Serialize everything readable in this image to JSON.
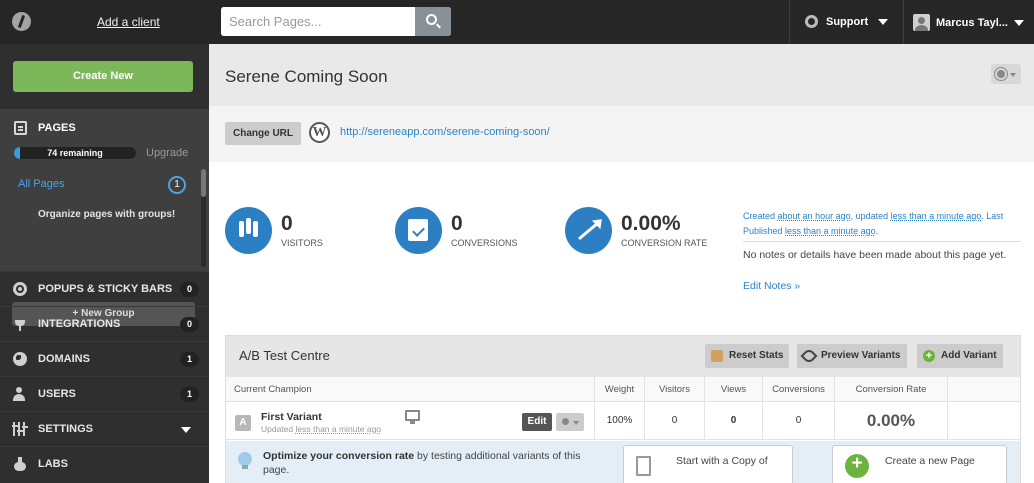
{
  "topbar": {
    "add_client": "Add a client",
    "search_placeholder": "Search Pages...",
    "support_label": "Support",
    "user_name": "Marcus Tayl..."
  },
  "sidebar": {
    "create_new": "Create New",
    "pages_label": "PAGES",
    "remaining_text": "74 remaining",
    "remaining_fraction": 0.05,
    "upgrade": "Upgrade",
    "all_pages": "All Pages",
    "all_pages_count": "1",
    "organize_text": "Organize pages with groups!",
    "new_group": "+ New Group",
    "items": [
      {
        "label": "POPUPS & STICKY BARS",
        "badge": "0",
        "icon": "popup-icon"
      },
      {
        "label": "INTEGRATIONS",
        "badge": "0",
        "icon": "plug-icon"
      },
      {
        "label": "DOMAINS",
        "badge": "1",
        "icon": "globe-icon"
      },
      {
        "label": "USERS",
        "badge": "1",
        "icon": "users-icon"
      },
      {
        "label": "SETTINGS",
        "badge": "",
        "icon": "settings-icon"
      },
      {
        "label": "LABS",
        "badge": "",
        "icon": "labs-icon"
      }
    ]
  },
  "page": {
    "title": "Serene Coming Soon",
    "change_url": "Change URL",
    "url": "http://sereneapp.com/serene-coming-soon/"
  },
  "stats": {
    "visitors": {
      "value": "0",
      "label": "VISITORS"
    },
    "conversions": {
      "value": "0",
      "label": "CONVERSIONS"
    },
    "rate": {
      "value": "0.00%",
      "label": "CONVERSION RATE"
    }
  },
  "meta": {
    "created_prefix": "Created ",
    "created_ago": "about an hour ago",
    "updated_prefix": ", updated ",
    "updated_ago": "less than a minute ago",
    "published_prefix": ". Last Published ",
    "published_ago": "less than a minute ago",
    "end": ".",
    "notes_text": "No notes or details have been made about this page yet.",
    "edit_notes": "Edit Notes »"
  },
  "ab": {
    "title": "A/B Test Centre",
    "reset_stats": "Reset Stats",
    "preview_variants": "Preview Variants",
    "add_variant": "Add Variant",
    "headers": {
      "champion": "Current Champion",
      "weight": "Weight",
      "visitors": "Visitors",
      "views": "Views",
      "conversions": "Conversions",
      "rate": "Conversion Rate"
    },
    "variant": {
      "letter": "A",
      "name": "First Variant",
      "updated_prefix": "Updated ",
      "updated_ago": "less than a minute ago",
      "edit": "Edit",
      "weight": "100%",
      "visitors": "0",
      "views": "0",
      "conversions": "0",
      "rate": "0.00%"
    },
    "optimize": {
      "bold": "Optimize your conversion rate",
      "rest": " by testing additional variants of this page.",
      "copy_btn": "Start with a Copy of",
      "new_btn": "Create a new Page"
    }
  },
  "colors": {
    "accent_blue": "#2d7fc4",
    "link_blue": "#2a84c8",
    "create_green": "#7cb85a",
    "topbar_bg": "#262626",
    "sidebar_bg": "#2f2f2f"
  }
}
